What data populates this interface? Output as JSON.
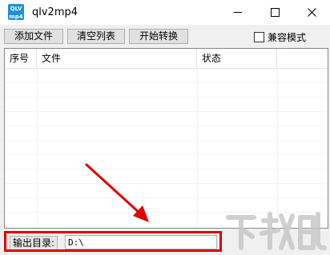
{
  "window": {
    "title": "qlv2mp4",
    "icon_text_top": "QLV",
    "icon_text_bottom": "mp4"
  },
  "toolbar": {
    "add_file": "添加文件",
    "clear_list": "清空列表",
    "start_convert": "开始转换",
    "compat_mode": "兼容模式",
    "compat_checked": false
  },
  "table": {
    "columns": [
      "序号",
      "文件",
      "状态",
      ""
    ],
    "rows": []
  },
  "output": {
    "label": "输出目录:",
    "path": "D:\\"
  },
  "annotation": {
    "color": "#e00000"
  },
  "watermark": {
    "text": "下载吧"
  },
  "icons": [
    "app-icon",
    "minimize-icon",
    "maximize-icon",
    "close-icon",
    "checkbox-icon",
    "annotation-arrow-icon"
  ]
}
